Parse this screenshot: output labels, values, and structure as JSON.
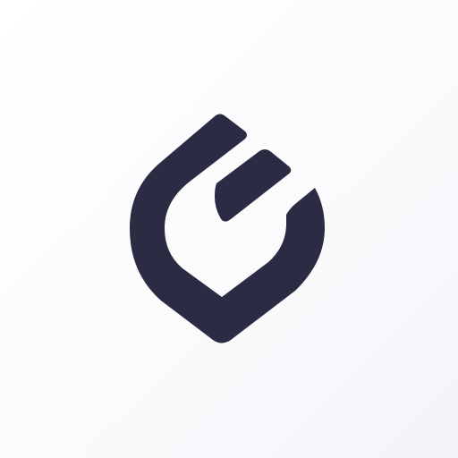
{
  "logo": {
    "icon": "app-logo-icon",
    "description_tokens": [
      "shield-outer-hook",
      "inner-bar"
    ],
    "colors": {
      "mark": "#2b2c43",
      "background_start": "#ffffff",
      "background_end": "#f5f3fa"
    }
  }
}
